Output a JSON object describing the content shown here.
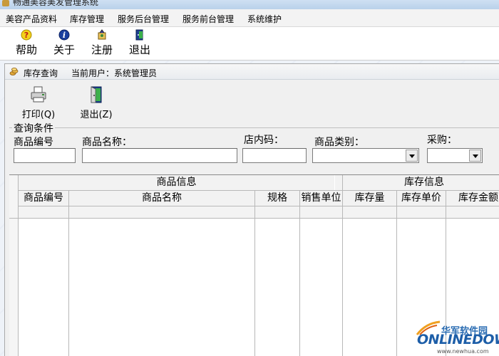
{
  "window": {
    "title": "畅通美容美发管理系统"
  },
  "menubar": {
    "items": [
      {
        "label": "美容产品资料"
      },
      {
        "label": "库存管理"
      },
      {
        "label": "服务后台管理"
      },
      {
        "label": "服务前台管理"
      },
      {
        "label": "系统维护"
      }
    ]
  },
  "toolbar": {
    "help_label": "帮助",
    "help_icon": "help-icon",
    "about_label": "关于",
    "about_icon": "info-icon",
    "register_label": "注册",
    "register_icon": "register-icon",
    "exit_label": "退出",
    "exit_icon": "exit-icon"
  },
  "child_window": {
    "title": "库存查询",
    "current_user": "当前用户：系统管理员",
    "icon": "coins-icon",
    "print_label": "打印(Q)",
    "print_icon": "printer-icon",
    "exit_label": "退出(Z)",
    "exit_icon": "door-exit-icon"
  },
  "query": {
    "group_title": "查询条件",
    "product_code_label": "商品编号",
    "product_code_value": "",
    "product_name_label": "商品名称：",
    "product_name_value": "",
    "store_code_label": "店内码：",
    "store_code_value": "",
    "category_label": "商品类别：",
    "category_value": "",
    "purchase_label": "采购：",
    "purchase_value": ""
  },
  "grid": {
    "group_headers": [
      "商品信息",
      "库存信息"
    ],
    "columns": [
      "商品编号",
      "商品名称",
      "规格",
      "销售单位",
      "库存量",
      "库存单价",
      "库存金额"
    ],
    "rows": []
  },
  "watermark": {
    "cn": "华军软件园",
    "en": "ONLINEDOWN",
    "url": "www.newhua.com"
  },
  "colors": {
    "accent": "#1d5ea8",
    "workspace": "#eef2f8"
  }
}
